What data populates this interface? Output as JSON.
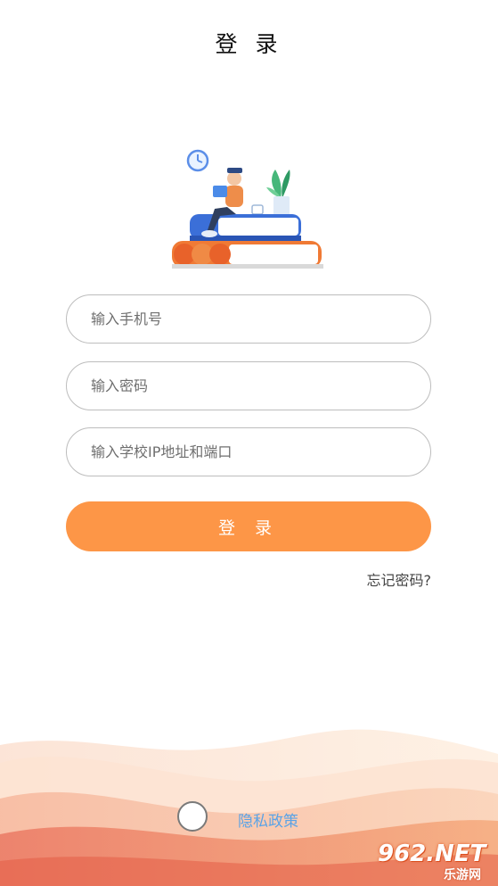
{
  "header": {
    "title": "登 录"
  },
  "form": {
    "phone_placeholder": "输入手机号",
    "password_placeholder": "输入密码",
    "school_ip_placeholder": "输入学校IP地址和端口"
  },
  "actions": {
    "login_label": "登 录",
    "forgot_label": "忘记密码?"
  },
  "footer": {
    "privacy_label": "隐私政策",
    "privacy_checked": false
  },
  "watermark": {
    "logo_text": "962.NET",
    "site_name": "乐游网"
  },
  "colors": {
    "accent": "#fd9647",
    "link": "#5aa3e6",
    "border": "#bdbdbd",
    "wave_light": "#fde8dc",
    "wave_dark": "#f08a69"
  },
  "icons": [
    "clock-icon",
    "plant-icon",
    "books-illustration"
  ]
}
